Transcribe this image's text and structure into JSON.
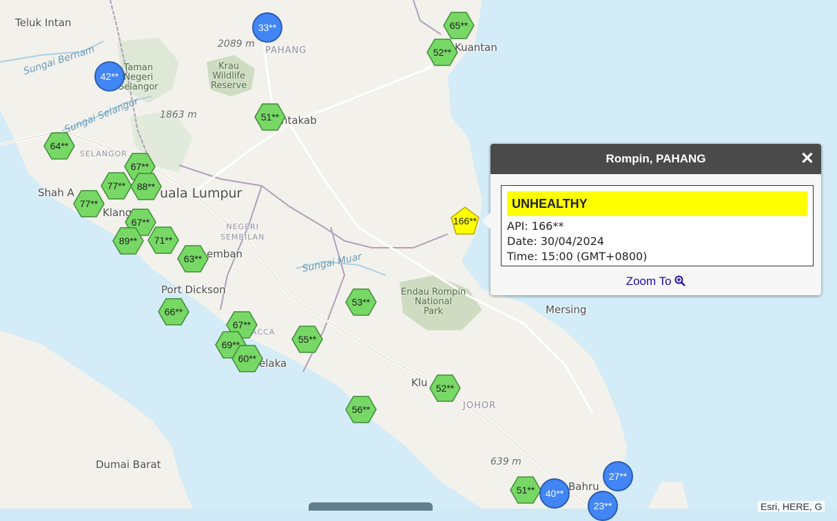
{
  "popup": {
    "title": "Rompin, PAHANG",
    "close_icon": "close-icon",
    "status": "UNHEALTHY",
    "status_color": "#ffff00",
    "api_line": "API: 166**",
    "date_line": "Date: 30/04/2024",
    "time_line": "Time: 15:00 (GMT+0800)",
    "zoom_label": "Zoom To",
    "zoom_icon": "zoom-in-icon"
  },
  "colors": {
    "good": "#77d866",
    "moderate": "#ffff00",
    "circle": "#4285f4",
    "sea": "#cfeaf6",
    "land": "#f3f2ee"
  },
  "map_labels": {
    "teluk_intan": "Teluk Intan",
    "pahang": "PAHANG",
    "kuantan": "Kuantan",
    "sungai_bernam": "Sungai Bernam",
    "taman": "Taman",
    "negeri": "Negeri",
    "selangor_park": "Selangor",
    "krau": "Krau",
    "wildlife": "Wildlife",
    "reserve": "Reserve",
    "elev_2089": "2089 m",
    "elev_1863": "1863 m",
    "elev_639": "639 m",
    "sungai_selangor": "Sungai Selangor",
    "temerloh_frag": "ntakab",
    "selangor": "SELANGOR",
    "shah_alam": "Shah A",
    "kuala_lumpur": "uala Lumpur",
    "klang": "Klang",
    "negeri_sembilan_1": "NEGERI",
    "negeri_sembilan_2": "SEMBILAN",
    "seremban": "emban",
    "sungai_muar": "Sungai Muar",
    "port_dickson": "Port Dickson",
    "endau_1": "Endau Rompin",
    "endau_2": "National",
    "endau_3": "Park",
    "mersing": "Mersing",
    "melaka_state": "ACCA",
    "melaka": "elaka",
    "kluang": "Klu",
    "johor": "JOHOR",
    "dumai": "Dumai Barat",
    "johor_bahru": "Bahru"
  },
  "markers": [
    {
      "label": "65**",
      "kind": "good"
    },
    {
      "label": "52**",
      "kind": "good"
    },
    {
      "label": "51**",
      "kind": "good"
    },
    {
      "label": "64**",
      "kind": "good"
    },
    {
      "label": "67**",
      "kind": "good"
    },
    {
      "label": "77**",
      "kind": "good"
    },
    {
      "label": "88**",
      "kind": "good"
    },
    {
      "label": "77**",
      "kind": "good"
    },
    {
      "label": "67**",
      "kind": "good"
    },
    {
      "label": "89**",
      "kind": "good"
    },
    {
      "label": "71**",
      "kind": "good"
    },
    {
      "label": "63**",
      "kind": "good"
    },
    {
      "label": "66**",
      "kind": "good"
    },
    {
      "label": "53**",
      "kind": "good"
    },
    {
      "label": "67**",
      "kind": "good"
    },
    {
      "label": "69**",
      "kind": "good"
    },
    {
      "label": "60**",
      "kind": "good"
    },
    {
      "label": "55**",
      "kind": "good"
    },
    {
      "label": "52**",
      "kind": "good"
    },
    {
      "label": "56**",
      "kind": "good"
    },
    {
      "label": "51**",
      "kind": "good"
    },
    {
      "label": "166**",
      "kind": "moderate"
    }
  ],
  "circles": [
    {
      "label": "33**"
    },
    {
      "label": "42**"
    },
    {
      "label": "27**"
    },
    {
      "label": "40**"
    },
    {
      "label": "23**"
    }
  ],
  "attribution": "Esri, HERE, G"
}
